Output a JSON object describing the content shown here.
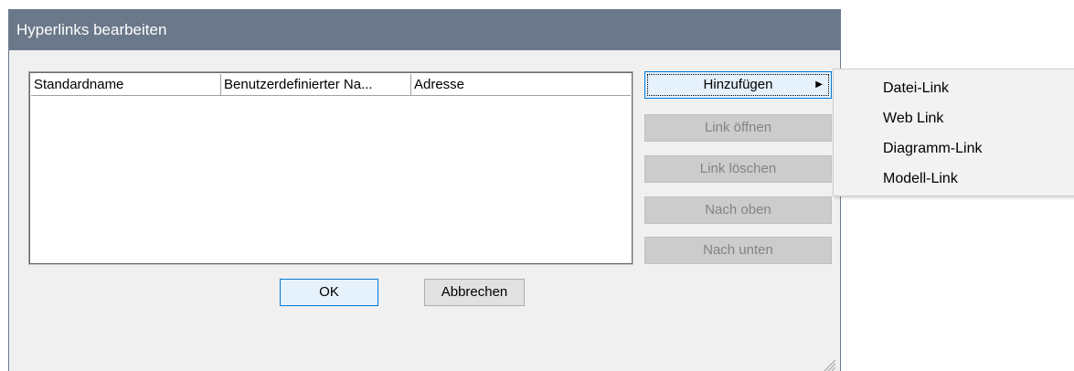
{
  "window": {
    "title": "Hyperlinks bearbeiten"
  },
  "table": {
    "columns": [
      "Standardname",
      "Benutzerdefinierter Na...",
      "Adresse"
    ],
    "rows": []
  },
  "side_buttons": {
    "add": "Hinzufügen",
    "open": "Link öffnen",
    "delete": "Link löschen",
    "up": "Nach oben",
    "down": "Nach unten"
  },
  "footer": {
    "ok": "OK",
    "cancel": "Abbrechen"
  },
  "add_menu": {
    "items": [
      "Datei-Link",
      "Web Link",
      "Diagramm-Link",
      "Modell-Link"
    ]
  },
  "colors": {
    "titlebar": "#6a788a",
    "focus": "#0078d7",
    "dialog_bg": "#f0f0f0"
  }
}
